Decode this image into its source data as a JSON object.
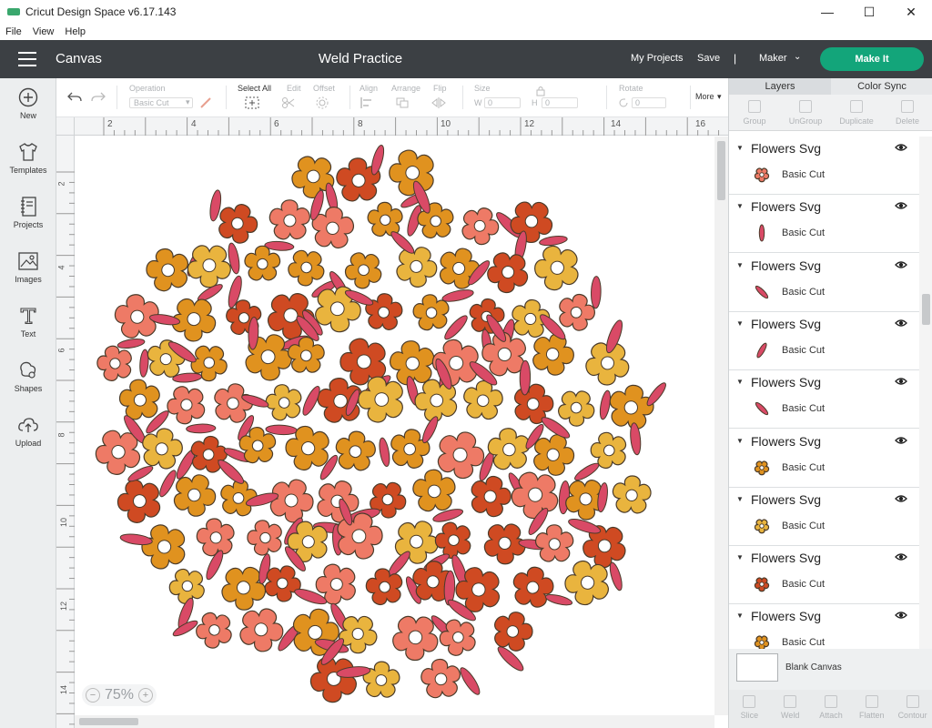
{
  "window": {
    "title": "Cricut Design Space  v6.17.143",
    "minimize": "—",
    "maximize": "☐",
    "close": "✕"
  },
  "menu": [
    "File",
    "View",
    "Help"
  ],
  "header": {
    "canvas_label": "Canvas",
    "project_title": "Weld Practice",
    "my_projects": "My Projects",
    "save": "Save",
    "separator": "|",
    "machine": "Maker",
    "make_it": "Make It"
  },
  "sidebar": [
    {
      "label": "New",
      "icon": "plus-circle-icon"
    },
    {
      "label": "Templates",
      "icon": "tshirt-icon"
    },
    {
      "label": "Projects",
      "icon": "notebook-icon"
    },
    {
      "label": "Images",
      "icon": "image-icon"
    },
    {
      "label": "Text",
      "icon": "text-icon"
    },
    {
      "label": "Shapes",
      "icon": "shapes-icon"
    },
    {
      "label": "Upload",
      "icon": "cloud-upload-icon"
    }
  ],
  "toolbar": {
    "operation_label": "Operation",
    "operation_value": "Basic Cut",
    "select_all": "Select All",
    "edit": "Edit",
    "offset": "Offset",
    "align": "Align",
    "arrange": "Arrange",
    "flip": "Flip",
    "size": "Size",
    "w": "W",
    "w_value": "0",
    "h": "H",
    "h_value": "0",
    "rotate": "Rotate",
    "rotate_value": "0",
    "more": "More"
  },
  "ruler": {
    "top": [
      "2",
      "4",
      "6",
      "8",
      "10",
      "12",
      "14",
      "16"
    ],
    "left": [
      "2",
      "4",
      "6",
      "8",
      "10",
      "12",
      "14"
    ]
  },
  "zoom": {
    "value": "75%",
    "minus": "−",
    "plus": "+"
  },
  "panel": {
    "tabs": [
      "Layers",
      "Color Sync"
    ],
    "actions": [
      "Group",
      "UnGroup",
      "Duplicate",
      "Delete"
    ],
    "layers": [
      {
        "name": "Flowers Svg",
        "operation": "Basic Cut",
        "thumb": "flower",
        "color": "#ee7a66"
      },
      {
        "name": "Flowers Svg",
        "operation": "Basic Cut",
        "thumb": "petal-v",
        "color": "#d94a66"
      },
      {
        "name": "Flowers Svg",
        "operation": "Basic Cut",
        "thumb": "petal-d",
        "color": "#d94a66"
      },
      {
        "name": "Flowers Svg",
        "operation": "Basic Cut",
        "thumb": "petal-u",
        "color": "#d94a66"
      },
      {
        "name": "Flowers Svg",
        "operation": "Basic Cut",
        "thumb": "petal-d",
        "color": "#d94a66"
      },
      {
        "name": "Flowers Svg",
        "operation": "Basic Cut",
        "thumb": "flower",
        "color": "#e0921f"
      },
      {
        "name": "Flowers Svg",
        "operation": "Basic Cut",
        "thumb": "flower",
        "color": "#e9b43e"
      },
      {
        "name": "Flowers Svg",
        "operation": "Basic Cut",
        "thumb": "flower",
        "color": "#cf4a22"
      },
      {
        "name": "Flowers Svg",
        "operation": "Basic Cut",
        "thumb": "flower",
        "color": "#e0921f"
      }
    ],
    "blank_canvas": "Blank Canvas",
    "bottom": [
      "Slice",
      "Weld",
      "Attach",
      "Flatten",
      "Contour"
    ]
  },
  "colors": {
    "header_bg": "#3c4044",
    "make_it": "#13a57a",
    "flower_colors": [
      "#ee7a66",
      "#e0921f",
      "#e9b43e",
      "#cf4a22"
    ],
    "petal_color": "#d94a66"
  }
}
